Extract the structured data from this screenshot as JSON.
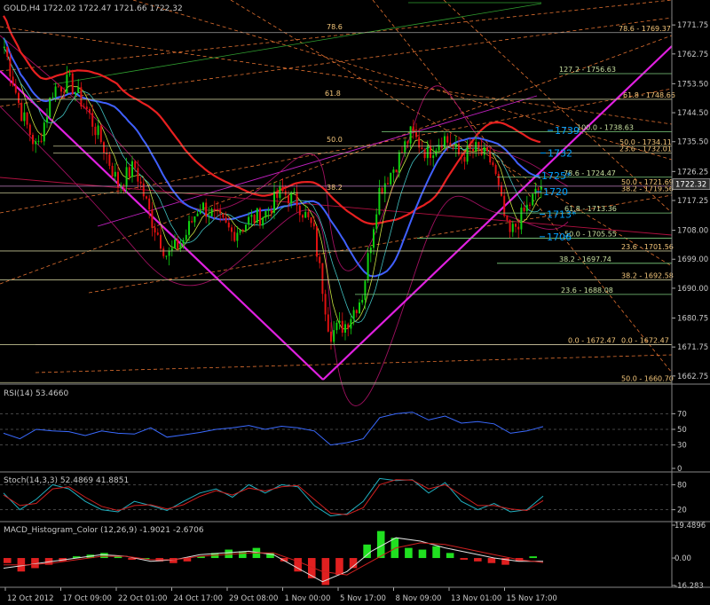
{
  "colors": {
    "background": "#000000",
    "grid": "#5a5a5a",
    "axis_text": "#c8c8c8",
    "fib_line": "#7fd17f",
    "fib_label": "#f5c77a",
    "fib_orange": "#e8a040",
    "trend_magenta": "#e020e0",
    "ma_red": "#e82020",
    "ma_blue": "#4060ff",
    "bollinger": "#a01060",
    "dashed_orange": "#e07030",
    "candle_up": "#10d010",
    "candle_down": "#e01010",
    "rsi_line": "#3a6aff",
    "stoch_main": "#20b0c0",
    "stoch_signal": "#d02020",
    "macd_pos": "#20e020",
    "macd_neg": "#e02020",
    "price_tag": "#00a0ff",
    "current_price_box": "#303030"
  },
  "header": {
    "symbol_line": "GOLD,H4  1722.02 1722.47 1721.66 1722.32"
  },
  "chart_data": [
    {
      "type": "candlestick",
      "title": "GOLD,H4  1722.02 1722.47 1721.66 1722.32",
      "ylim": [
        1660.5,
        1779.5
      ],
      "y_ticks": [
        1771.75,
        1762.75,
        1753.5,
        1744.5,
        1735.5,
        1726.25,
        1717.25,
        1708.0,
        1699.0,
        1690.0,
        1680.75,
        1671.75,
        1662.75
      ],
      "current_price": 1722.32,
      "x_ticks": [
        "12 Oct 2012",
        "17 Oct 09:00",
        "22 Oct 01:00",
        "24 Oct 17:00",
        "29 Oct 08:00",
        "1 Nov 00:00",
        "5 Nov 17:00",
        "8 Nov 09:00",
        "13 Nov 01:00",
        "15 Nov 17:00"
      ],
      "price_path": [
        1765,
        1745,
        1733,
        1752,
        1754,
        1746,
        1735,
        1722,
        1728,
        1712,
        1700,
        1705,
        1716,
        1712,
        1707,
        1711,
        1713,
        1720,
        1717,
        1708,
        1676,
        1679,
        1688,
        1720,
        1728,
        1738,
        1732,
        1737,
        1731,
        1733,
        1729,
        1706,
        1714,
        1722
      ],
      "fib_levels": [
        {
          "label": "78.6 - 1769.37",
          "value": 1769.37
        },
        {
          "label": "127.2 - 1756.63",
          "value": 1756.63
        },
        {
          "label": "61.8 - 1748.66",
          "value": 1748.66
        },
        {
          "label": "100.0 - 1738.63",
          "value": 1738.63
        },
        {
          "label": "50.0 - 1734.11",
          "value": 1734.11
        },
        {
          "label": "23.6 - 1732.01",
          "value": 1732.01
        },
        {
          "label": "78.6 - 1724.47",
          "value": 1724.47
        },
        {
          "label": "50.0 - 1721.69",
          "value": 1721.69
        },
        {
          "label": "38.2 - 1719.56",
          "value": 1719.56
        },
        {
          "label": "61.8 - 1713.36",
          "value": 1713.36
        },
        {
          "label": "50.0 - 1705.55",
          "value": 1705.55
        },
        {
          "label": "23.6 - 1701.56",
          "value": 1701.56
        },
        {
          "label": "38.2 - 1697.74",
          "value": 1697.74
        },
        {
          "label": "38.2 - 1692.58",
          "value": 1692.58
        },
        {
          "label": "23.6 - 1688.08",
          "value": 1688.08
        },
        {
          "label": "0.0 - 1672.47",
          "value": 1672.47
        },
        {
          "label": "0.0 - 1672.47",
          "value": 1672.47
        },
        {
          "label": "50.0 - 1660.70",
          "value": 1660.7
        }
      ],
      "fib_floating_labels": [
        "78.6",
        "61.8",
        "50.0",
        "38.2"
      ],
      "price_tags": [
        {
          "label": "1739",
          "value": 1739
        },
        {
          "label": "1732",
          "value": 1732
        },
        {
          "label": "1725*",
          "value": 1725
        },
        {
          "label": "1720",
          "value": 1720
        },
        {
          "label": "1713*",
          "value": 1713
        },
        {
          "label": "1706",
          "value": 1706
        }
      ]
    },
    {
      "type": "line",
      "title": "RSI(14) 53.4660",
      "ylim": [
        0,
        100
      ],
      "y_ticks": [
        70,
        50,
        30,
        0
      ],
      "levels": [
        70,
        50,
        30
      ],
      "series": [
        {
          "values": [
            45,
            38,
            50,
            48,
            47,
            42,
            48,
            45,
            44,
            52,
            40,
            43,
            46,
            50,
            52,
            55,
            50,
            54,
            52,
            48,
            30,
            33,
            38,
            65,
            70,
            72,
            62,
            67,
            58,
            60,
            57,
            45,
            48,
            53.466
          ]
        }
      ]
    },
    {
      "type": "line",
      "title": "Stoch(14,3,3) 52.4869 41.8851",
      "ylim": [
        0,
        100
      ],
      "y_ticks": [
        80,
        20
      ],
      "levels": [
        80,
        20
      ],
      "series": [
        {
          "values": [
            60,
            20,
            45,
            80,
            70,
            40,
            20,
            15,
            40,
            30,
            18,
            40,
            60,
            70,
            50,
            80,
            60,
            80,
            75,
            30,
            5,
            10,
            40,
            95,
            90,
            92,
            60,
            85,
            40,
            20,
            35,
            15,
            20,
            52.4869
          ]
        },
        {
          "values": [
            55,
            30,
            35,
            70,
            75,
            50,
            28,
            18,
            30,
            32,
            22,
            32,
            52,
            66,
            55,
            72,
            65,
            75,
            78,
            45,
            12,
            8,
            25,
            80,
            92,
            91,
            70,
            80,
            55,
            30,
            30,
            22,
            18,
            41.8851
          ]
        }
      ]
    },
    {
      "type": "bar",
      "title": "MACD_Histogram_Color (12,26,9) -1.9021 -2.6706",
      "ylim": [
        -16.283,
        19.4896
      ],
      "y_ticks": [
        19.4896,
        0.0,
        -16.283
      ],
      "values": [
        -3,
        -8,
        -6,
        -4,
        -2,
        1,
        2,
        3,
        1,
        -1,
        0,
        -2,
        -3,
        -2,
        1,
        3,
        5,
        4,
        6,
        3,
        -2,
        -8,
        -12,
        -16,
        -10,
        -6,
        8,
        16,
        12,
        6,
        5,
        7,
        3,
        -1,
        -2,
        -3,
        -4,
        -2,
        1
      ],
      "macd_line": [
        -6,
        -4,
        -2,
        0,
        2,
        1,
        -2,
        -1,
        2,
        3,
        4,
        2,
        -6,
        -14,
        -8,
        4,
        12,
        10,
        6,
        3,
        0,
        -2,
        -1.9021
      ],
      "signal_line": [
        -4,
        -4,
        -3,
        -1,
        1,
        1,
        -1,
        -1,
        1,
        2,
        3,
        3,
        -2,
        -8,
        -10,
        -2,
        6,
        9,
        8,
        5,
        2,
        -1,
        -2.6706
      ]
    }
  ]
}
